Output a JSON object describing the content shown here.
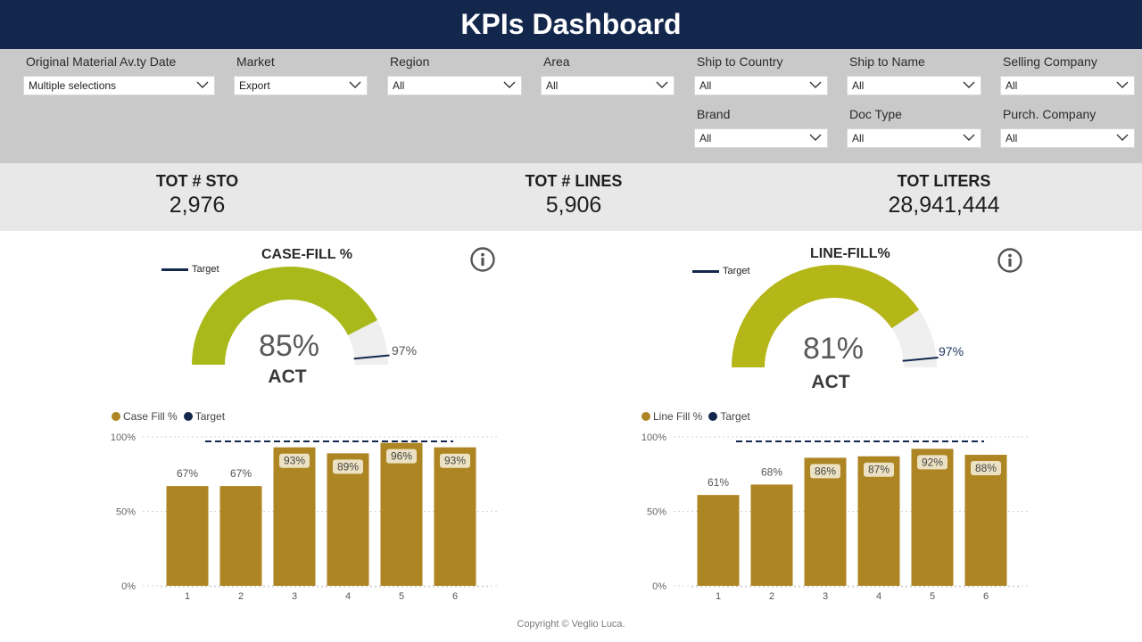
{
  "header": {
    "title": "KPIs Dashboard"
  },
  "filters": [
    {
      "label": "Original Material Av.ty Date",
      "value": "Multiple selections"
    },
    {
      "label": "Market",
      "value": "Export"
    },
    {
      "label": "Region",
      "value": "All"
    },
    {
      "label": "Area",
      "value": "All"
    },
    {
      "label": "Ship to Country",
      "value": "All"
    },
    {
      "label": "Ship to Name",
      "value": "All"
    },
    {
      "label": "Selling Company",
      "value": "All"
    },
    {
      "label": "Brand",
      "value": "All"
    },
    {
      "label": "Doc Type",
      "value": "All"
    },
    {
      "label": "Purch. Company",
      "value": "All"
    }
  ],
  "kpis": [
    {
      "title": "TOT # STO",
      "value": "2,976"
    },
    {
      "title": "TOT # LINES",
      "value": "5,906"
    },
    {
      "title": "TOT LITERS",
      "value": "28,941,444"
    }
  ],
  "case_fill": {
    "title": "CASE-FILL %",
    "target_legend": "Target",
    "actual_text": "85%",
    "actual_label": "ACT",
    "target_text": "97%",
    "actual_value": 85,
    "target_value": 97,
    "gauge_color": "#a9b919",
    "target_color": "#13274d"
  },
  "line_fill": {
    "title": "LINE-FILL%",
    "target_legend": "Target",
    "actual_text": "81%",
    "actual_label": "ACT",
    "target_text": "97%",
    "actual_value": 81,
    "target_value": 97,
    "gauge_color": "#b5b618",
    "target_color": "#13274d"
  },
  "chart_data": [
    {
      "type": "bar",
      "categories": [
        "1",
        "2",
        "3",
        "4",
        "5",
        "6"
      ],
      "series": [
        {
          "name": "Case Fill %",
          "values": [
            67,
            67,
            93,
            89,
            96,
            93
          ],
          "color": "#ad8522"
        },
        {
          "name": "Target",
          "values": [
            97,
            97,
            97,
            97,
            97,
            97
          ],
          "color": "#13274d"
        }
      ],
      "data_labels": [
        "67%",
        "67%",
        "93%",
        "89%",
        "96%",
        "93%"
      ],
      "y_ticks": [
        "0%",
        "50%",
        "100%"
      ],
      "ylim": [
        0,
        100
      ],
      "grid": true,
      "legend_position": "top-left"
    },
    {
      "type": "bar",
      "categories": [
        "1",
        "2",
        "3",
        "4",
        "5",
        "6"
      ],
      "series": [
        {
          "name": "Line Fill %",
          "values": [
            61,
            68,
            86,
            87,
            92,
            88
          ],
          "color": "#ad8522"
        },
        {
          "name": "Target",
          "values": [
            97,
            97,
            97,
            97,
            97,
            97
          ],
          "color": "#13274d"
        }
      ],
      "data_labels": [
        "61%",
        "68%",
        "86%",
        "87%",
        "92%",
        "88%"
      ],
      "y_ticks": [
        "0%",
        "50%",
        "100%"
      ],
      "ylim": [
        0,
        100
      ],
      "grid": true,
      "legend_position": "top-left"
    }
  ],
  "footer": {
    "text": "Copyright © Veglio Luca."
  }
}
